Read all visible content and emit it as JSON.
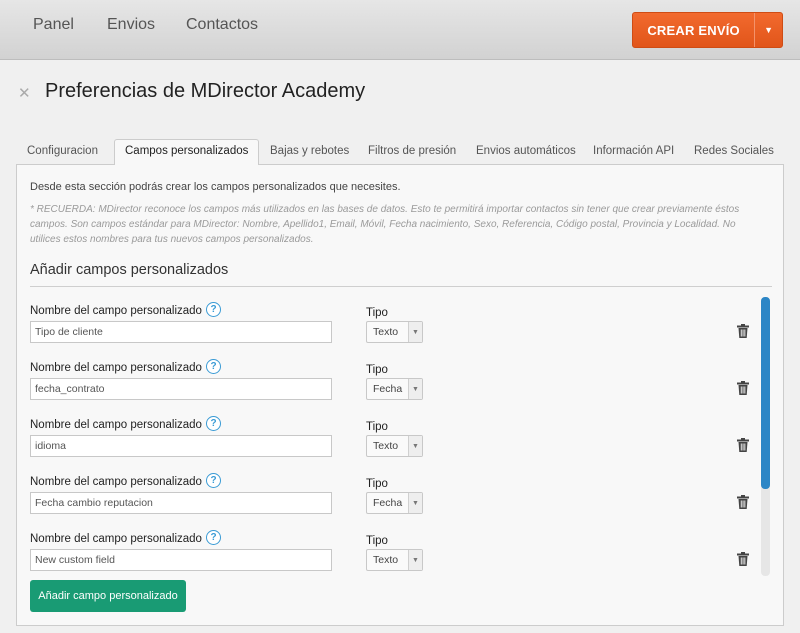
{
  "nav": {
    "items": [
      "Panel",
      "Envios",
      "Contactos"
    ]
  },
  "create_button": {
    "label": "CREAR ENVÍO",
    "color": "#e8601f"
  },
  "page": {
    "title": "Preferencias de MDirector Academy"
  },
  "tabs": [
    "Configuracion",
    "Campos personalizados",
    "Bajas y rebotes",
    "Filtros de presión",
    "Envios automáticos",
    "Información API",
    "Redes Sociales"
  ],
  "active_tab": "Campos personalizados",
  "intro": "Desde esta sección podrás crear los campos personalizados que necesites.",
  "note": "* RECUERDA: MDirector reconoce los campos más utilizados en las bases de datos. Esto te permitirá importar contactos sin tener que crear previamente éstos campos. Son campos estándar para MDirector: Nombre, Apellido1, Email, Móvil, Fecha nacimiento, Sexo, Referencia, Código postal, Provincia y Localidad. No utilices estos nombres para tus nuevos campos personalizados.",
  "section_title": "Añadir campos personalizados",
  "fields": [
    {
      "label": "Nombre del campo personalizado",
      "value": "Tipo de cliente",
      "type_label": "Tipo",
      "type": "Texto"
    },
    {
      "label": "Nombre del campo personalizado",
      "value": "fecha_contrato",
      "type_label": "Tipo",
      "type": "Fecha"
    },
    {
      "label": "Nombre del campo personalizado",
      "value": "idioma",
      "type_label": "Tipo",
      "type": "Texto"
    },
    {
      "label": "Nombre del campo personalizado",
      "value": "Fecha cambio reputacion",
      "type_label": "Tipo",
      "type": "Fecha"
    },
    {
      "label": "Nombre del campo personalizado",
      "value": "New custom field",
      "type_label": "Tipo",
      "type": "Texto"
    }
  ],
  "add_button": {
    "label": "Añadir campo personalizado",
    "color": "#199b74"
  },
  "icons": {
    "help": "help-icon",
    "trash": "trash-icon",
    "tools": "tools-icon"
  }
}
